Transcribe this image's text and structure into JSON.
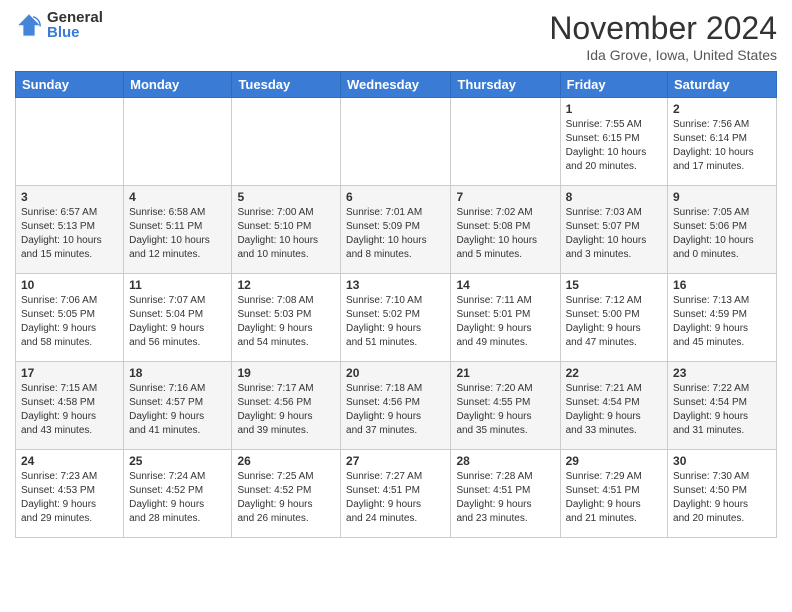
{
  "logo": {
    "general": "General",
    "blue": "Blue"
  },
  "header": {
    "month": "November 2024",
    "location": "Ida Grove, Iowa, United States"
  },
  "weekdays": [
    "Sunday",
    "Monday",
    "Tuesday",
    "Wednesday",
    "Thursday",
    "Friday",
    "Saturday"
  ],
  "weeks": [
    [
      {
        "day": "",
        "info": ""
      },
      {
        "day": "",
        "info": ""
      },
      {
        "day": "",
        "info": ""
      },
      {
        "day": "",
        "info": ""
      },
      {
        "day": "",
        "info": ""
      },
      {
        "day": "1",
        "info": "Sunrise: 7:55 AM\nSunset: 6:15 PM\nDaylight: 10 hours\nand 20 minutes."
      },
      {
        "day": "2",
        "info": "Sunrise: 7:56 AM\nSunset: 6:14 PM\nDaylight: 10 hours\nand 17 minutes."
      }
    ],
    [
      {
        "day": "3",
        "info": "Sunrise: 6:57 AM\nSunset: 5:13 PM\nDaylight: 10 hours\nand 15 minutes."
      },
      {
        "day": "4",
        "info": "Sunrise: 6:58 AM\nSunset: 5:11 PM\nDaylight: 10 hours\nand 12 minutes."
      },
      {
        "day": "5",
        "info": "Sunrise: 7:00 AM\nSunset: 5:10 PM\nDaylight: 10 hours\nand 10 minutes."
      },
      {
        "day": "6",
        "info": "Sunrise: 7:01 AM\nSunset: 5:09 PM\nDaylight: 10 hours\nand 8 minutes."
      },
      {
        "day": "7",
        "info": "Sunrise: 7:02 AM\nSunset: 5:08 PM\nDaylight: 10 hours\nand 5 minutes."
      },
      {
        "day": "8",
        "info": "Sunrise: 7:03 AM\nSunset: 5:07 PM\nDaylight: 10 hours\nand 3 minutes."
      },
      {
        "day": "9",
        "info": "Sunrise: 7:05 AM\nSunset: 5:06 PM\nDaylight: 10 hours\nand 0 minutes."
      }
    ],
    [
      {
        "day": "10",
        "info": "Sunrise: 7:06 AM\nSunset: 5:05 PM\nDaylight: 9 hours\nand 58 minutes."
      },
      {
        "day": "11",
        "info": "Sunrise: 7:07 AM\nSunset: 5:04 PM\nDaylight: 9 hours\nand 56 minutes."
      },
      {
        "day": "12",
        "info": "Sunrise: 7:08 AM\nSunset: 5:03 PM\nDaylight: 9 hours\nand 54 minutes."
      },
      {
        "day": "13",
        "info": "Sunrise: 7:10 AM\nSunset: 5:02 PM\nDaylight: 9 hours\nand 51 minutes."
      },
      {
        "day": "14",
        "info": "Sunrise: 7:11 AM\nSunset: 5:01 PM\nDaylight: 9 hours\nand 49 minutes."
      },
      {
        "day": "15",
        "info": "Sunrise: 7:12 AM\nSunset: 5:00 PM\nDaylight: 9 hours\nand 47 minutes."
      },
      {
        "day": "16",
        "info": "Sunrise: 7:13 AM\nSunset: 4:59 PM\nDaylight: 9 hours\nand 45 minutes."
      }
    ],
    [
      {
        "day": "17",
        "info": "Sunrise: 7:15 AM\nSunset: 4:58 PM\nDaylight: 9 hours\nand 43 minutes."
      },
      {
        "day": "18",
        "info": "Sunrise: 7:16 AM\nSunset: 4:57 PM\nDaylight: 9 hours\nand 41 minutes."
      },
      {
        "day": "19",
        "info": "Sunrise: 7:17 AM\nSunset: 4:56 PM\nDaylight: 9 hours\nand 39 minutes."
      },
      {
        "day": "20",
        "info": "Sunrise: 7:18 AM\nSunset: 4:56 PM\nDaylight: 9 hours\nand 37 minutes."
      },
      {
        "day": "21",
        "info": "Sunrise: 7:20 AM\nSunset: 4:55 PM\nDaylight: 9 hours\nand 35 minutes."
      },
      {
        "day": "22",
        "info": "Sunrise: 7:21 AM\nSunset: 4:54 PM\nDaylight: 9 hours\nand 33 minutes."
      },
      {
        "day": "23",
        "info": "Sunrise: 7:22 AM\nSunset: 4:54 PM\nDaylight: 9 hours\nand 31 minutes."
      }
    ],
    [
      {
        "day": "24",
        "info": "Sunrise: 7:23 AM\nSunset: 4:53 PM\nDaylight: 9 hours\nand 29 minutes."
      },
      {
        "day": "25",
        "info": "Sunrise: 7:24 AM\nSunset: 4:52 PM\nDaylight: 9 hours\nand 28 minutes."
      },
      {
        "day": "26",
        "info": "Sunrise: 7:25 AM\nSunset: 4:52 PM\nDaylight: 9 hours\nand 26 minutes."
      },
      {
        "day": "27",
        "info": "Sunrise: 7:27 AM\nSunset: 4:51 PM\nDaylight: 9 hours\nand 24 minutes."
      },
      {
        "day": "28",
        "info": "Sunrise: 7:28 AM\nSunset: 4:51 PM\nDaylight: 9 hours\nand 23 minutes."
      },
      {
        "day": "29",
        "info": "Sunrise: 7:29 AM\nSunset: 4:51 PM\nDaylight: 9 hours\nand 21 minutes."
      },
      {
        "day": "30",
        "info": "Sunrise: 7:30 AM\nSunset: 4:50 PM\nDaylight: 9 hours\nand 20 minutes."
      }
    ]
  ]
}
